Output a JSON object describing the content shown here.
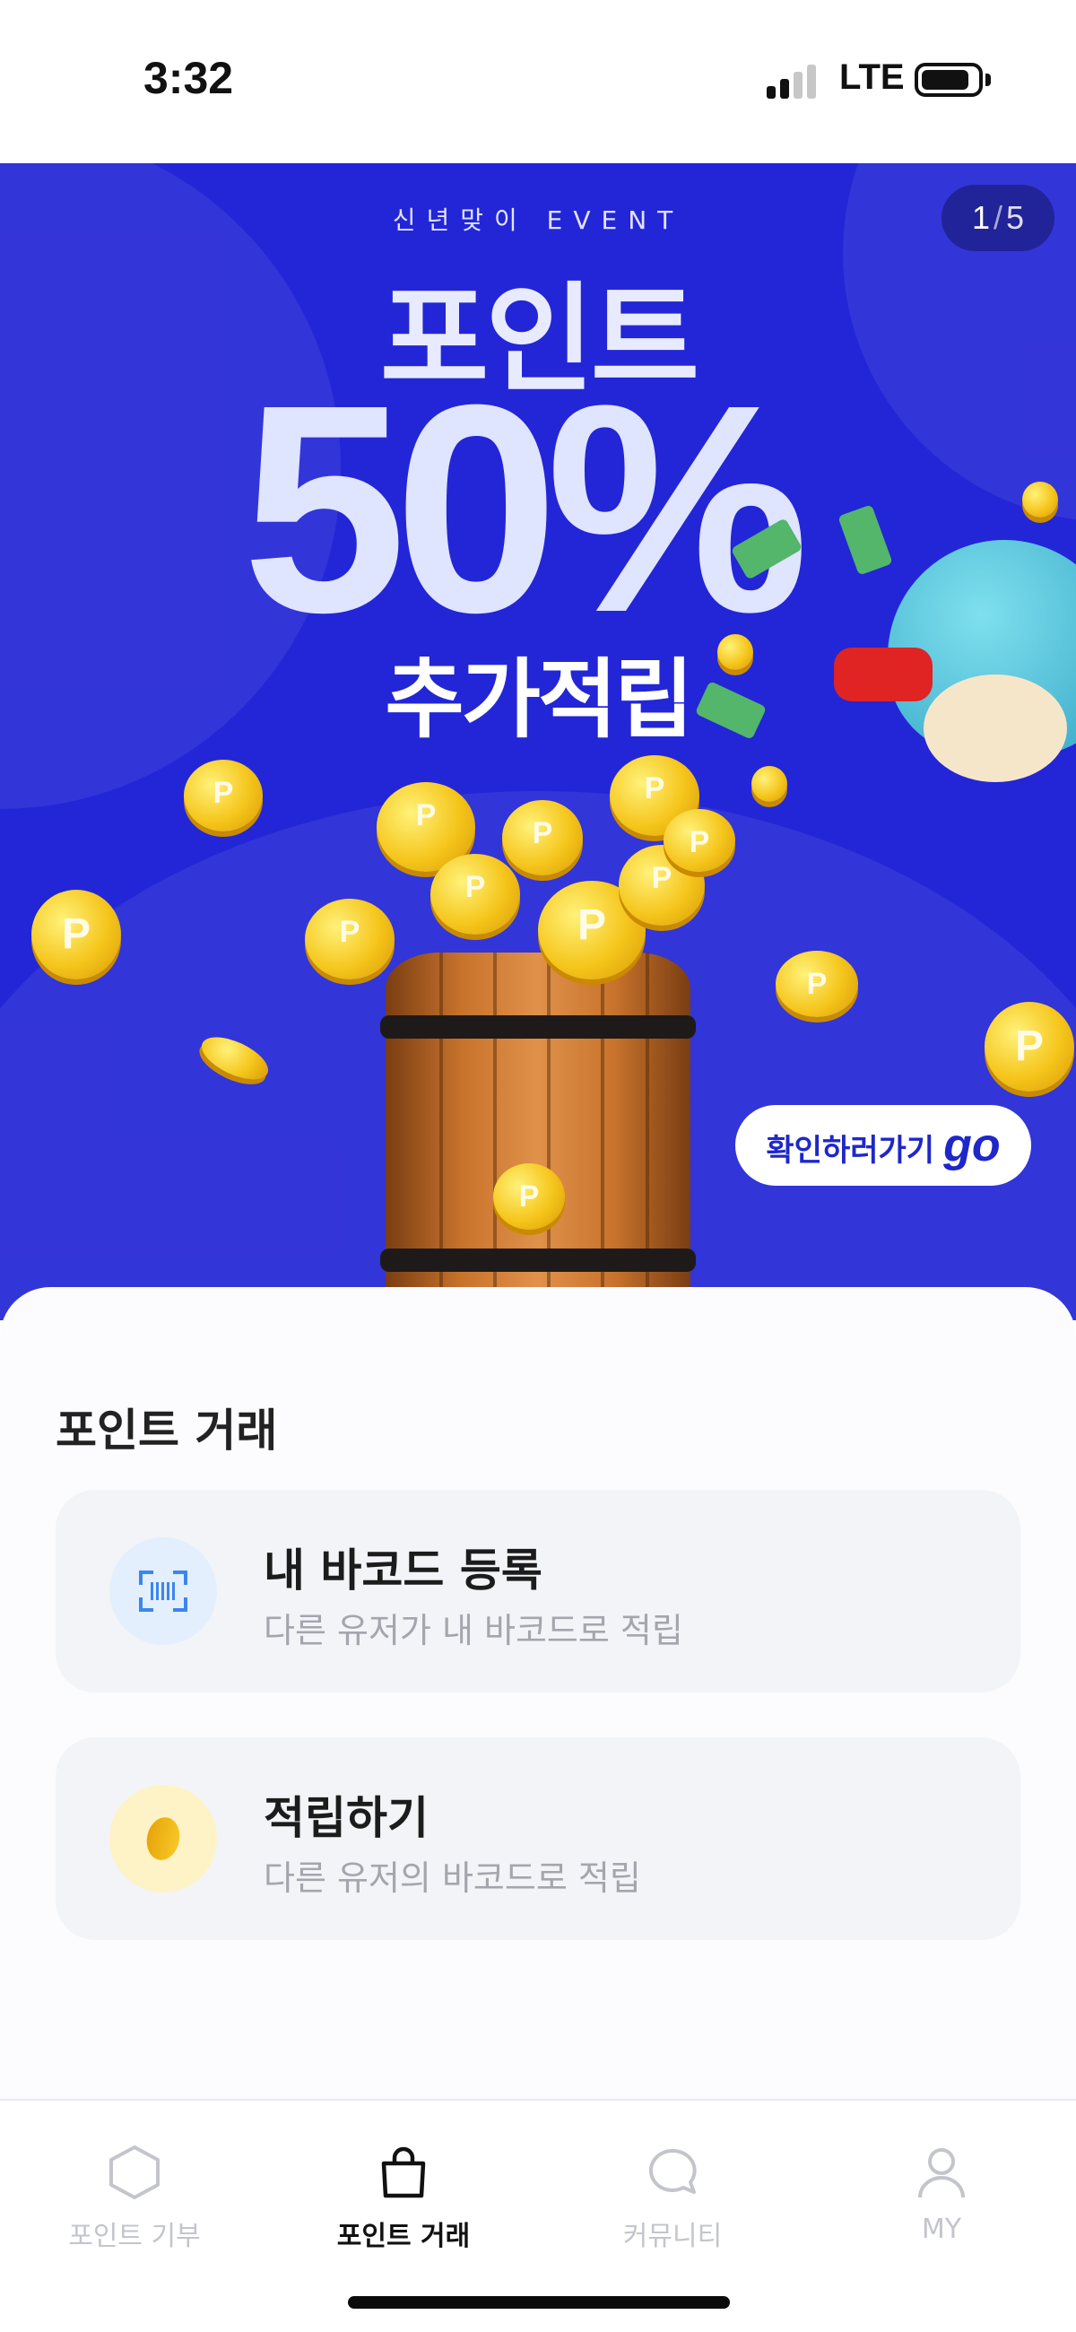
{
  "status_bar": {
    "time": "3:32",
    "network": "LTE"
  },
  "banner": {
    "page_current": "1",
    "page_total": "5",
    "event_label": "신년맞이 EVENT",
    "headline_1": "포인트",
    "headline_2": "50%",
    "headline_3": "추가적립",
    "cta_label": "확인하러가기",
    "cta_go": "go"
  },
  "section": {
    "title": "포인트 거래",
    "cards": [
      {
        "title": "내 바코드 등록",
        "subtitle": "다른 유저가 내 바코드로 적립",
        "icon": "barcode-scan-icon"
      },
      {
        "title": "적립하기",
        "subtitle": "다른 유저의 바코드로 적립",
        "icon": "coin-icon"
      }
    ]
  },
  "tab_bar": {
    "tabs": [
      {
        "label": "포인트 기부",
        "icon": "hexagon-icon",
        "active": false
      },
      {
        "label": "포인트 거래",
        "icon": "shopping-bag-icon",
        "active": true
      },
      {
        "label": "커뮤니티",
        "icon": "chat-bubble-icon",
        "active": false
      },
      {
        "label": "MY",
        "icon": "person-icon",
        "active": false
      }
    ]
  },
  "colors": {
    "banner_bg": "#2326d6",
    "accent_blue": "#3c86f0",
    "coin_yellow": "#f8c726",
    "card_bg": "#f3f4f7"
  }
}
